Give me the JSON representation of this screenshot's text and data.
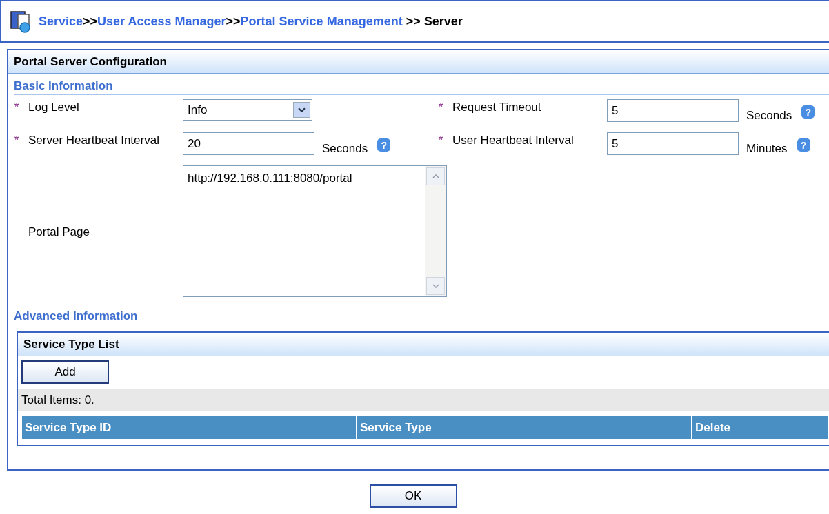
{
  "breadcrumb": [
    {
      "text": "Service",
      "kind": "link"
    },
    {
      "text": ">>",
      "kind": "sep"
    },
    {
      "text": "User Access Manager",
      "kind": "link"
    },
    {
      "text": ">>",
      "kind": "sep"
    },
    {
      "text": "Portal Service Management",
      "kind": "link"
    },
    {
      "text": ">> Server",
      "kind": "current"
    }
  ],
  "panel": {
    "title": "Portal Server Configuration",
    "basic": {
      "title": "Basic Information",
      "fields": [
        {
          "label": "Log Level",
          "required_mark": "*",
          "kind": "select",
          "value": "Info"
        },
        {
          "label": "Request Timeout",
          "required_mark": "*",
          "kind": "text",
          "value": "5",
          "unit": "Seconds",
          "help": "?"
        },
        {
          "label": "Server Heartbeat Interval",
          "required_mark": "*",
          "kind": "text",
          "value": "20",
          "unit": "Seconds",
          "help": "?"
        },
        {
          "label": "User Heartbeat Interval",
          "required_mark": "*",
          "kind": "text",
          "value": "5",
          "unit": "Minutes",
          "help": "?"
        },
        {
          "label": "Portal Page",
          "kind": "textarea",
          "value": "http://192.168.0.111:8080/portal"
        }
      ]
    },
    "advanced": {
      "title": "Advanced Information",
      "list": {
        "title": "Service Type List",
        "add_button": "Add",
        "total": "Total Items: 0.",
        "columns": [
          "Service Type ID",
          "Service Type",
          "Delete"
        ]
      }
    }
  },
  "ok_button": "OK"
}
